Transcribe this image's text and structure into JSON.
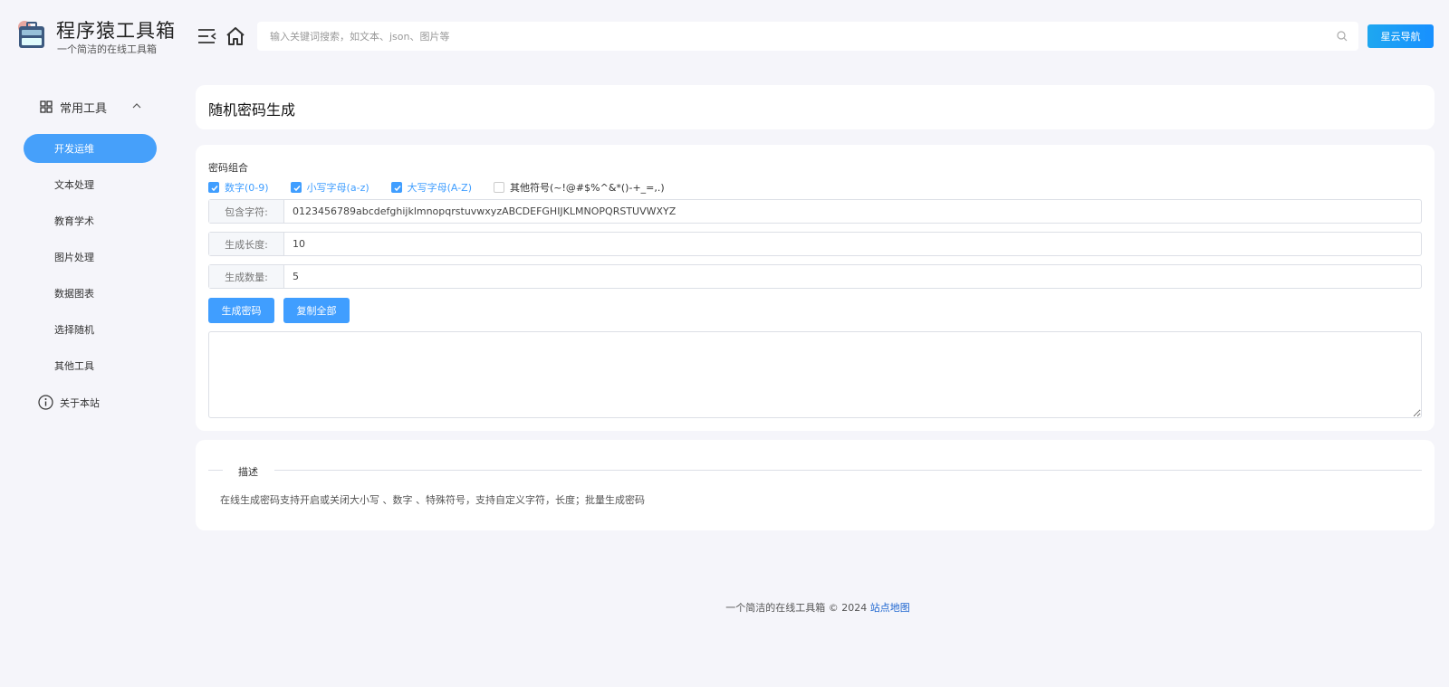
{
  "header": {
    "site_title": "程序猿工具箱",
    "site_subtitle": "一个简洁的在线工具箱",
    "search_placeholder": "输入关键词搜索，如文本、json、图片等",
    "nav_button": "星云导航"
  },
  "sidebar": {
    "group_label": "常用工具",
    "items": [
      {
        "label": "开发运维",
        "active": true
      },
      {
        "label": "文本处理"
      },
      {
        "label": "教育学术"
      },
      {
        "label": "图片处理"
      },
      {
        "label": "数据图表"
      },
      {
        "label": "选择随机"
      },
      {
        "label": "其他工具"
      }
    ],
    "about_label": "关于本站"
  },
  "main": {
    "title": "随机密码生成",
    "combo_label": "密码组合",
    "checkboxes": [
      {
        "label": "数字(0-9)",
        "checked": true
      },
      {
        "label": "小写字母(a-z)",
        "checked": true
      },
      {
        "label": "大写字母(A-Z)",
        "checked": true
      },
      {
        "label": "其他符号(~!@#$%^&*()-+_=,.)",
        "checked": false
      }
    ],
    "fields": {
      "chars_label": "包含字符:",
      "chars_value": "0123456789abcdefghijklmnopqrstuvwxyzABCDEFGHIJKLMNOPQRSTUVWXYZ",
      "length_label": "生成长度:",
      "length_value": "10",
      "count_label": "生成数量:",
      "count_value": "5"
    },
    "generate_button": "生成密码",
    "copy_button": "复制全部",
    "output_value": ""
  },
  "description": {
    "title": "描述",
    "text": "在线生成密码支持开启或关闭大小写 、数字 、特殊符号，支持自定义字符，长度；批量生成密码"
  },
  "footer": {
    "text": "一个简洁的在线工具箱 © 2024 ",
    "link": "站点地图"
  },
  "colors": {
    "accent": "#409eff",
    "active_nav": "#46a0fa",
    "nav_button": "#1890ff",
    "background": "#f5f5fa"
  }
}
